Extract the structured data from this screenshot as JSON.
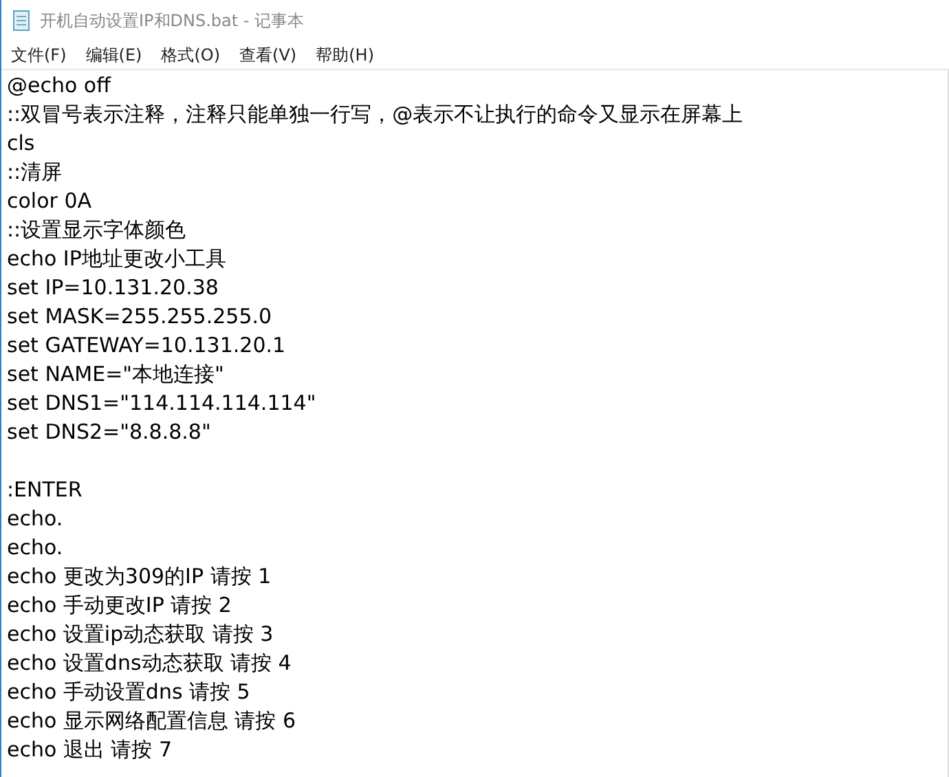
{
  "window": {
    "title": "开机自动设置IP和DNS.bat - 记事本"
  },
  "menu": [
    "文件(F)",
    "编辑(E)",
    "格式(O)",
    "查看(V)",
    "帮助(H)"
  ],
  "editor": {
    "blocks": [
      [
        "@echo off",
        "::双冒号表示注释，注释只能单独一行写，@表示不让执行的命令又显示在屏幕上",
        "cls",
        "::清屏",
        "color 0A",
        "::设置显示字体颜色",
        "echo IP地址更改小工具",
        "set IP=10.131.20.38",
        "set MASK=255.255.255.0",
        "set GATEWAY=10.131.20.1",
        "set NAME=\"本地连接\"",
        "set DNS1=\"114.114.114.114\"",
        "set DNS2=\"8.8.8.8\""
      ],
      [
        ":ENTER",
        "echo.",
        "echo.",
        "echo 更改为309的IP 请按 1",
        "echo 手动更改IP 请按 2",
        "echo 设置ip动态获取 请按 3",
        "echo 设置dns动态获取 请按 4",
        "echo 手动设置dns 请按 5",
        "echo 显示网络配置信息 请按 6",
        "echo 退出 请按 7"
      ]
    ]
  }
}
